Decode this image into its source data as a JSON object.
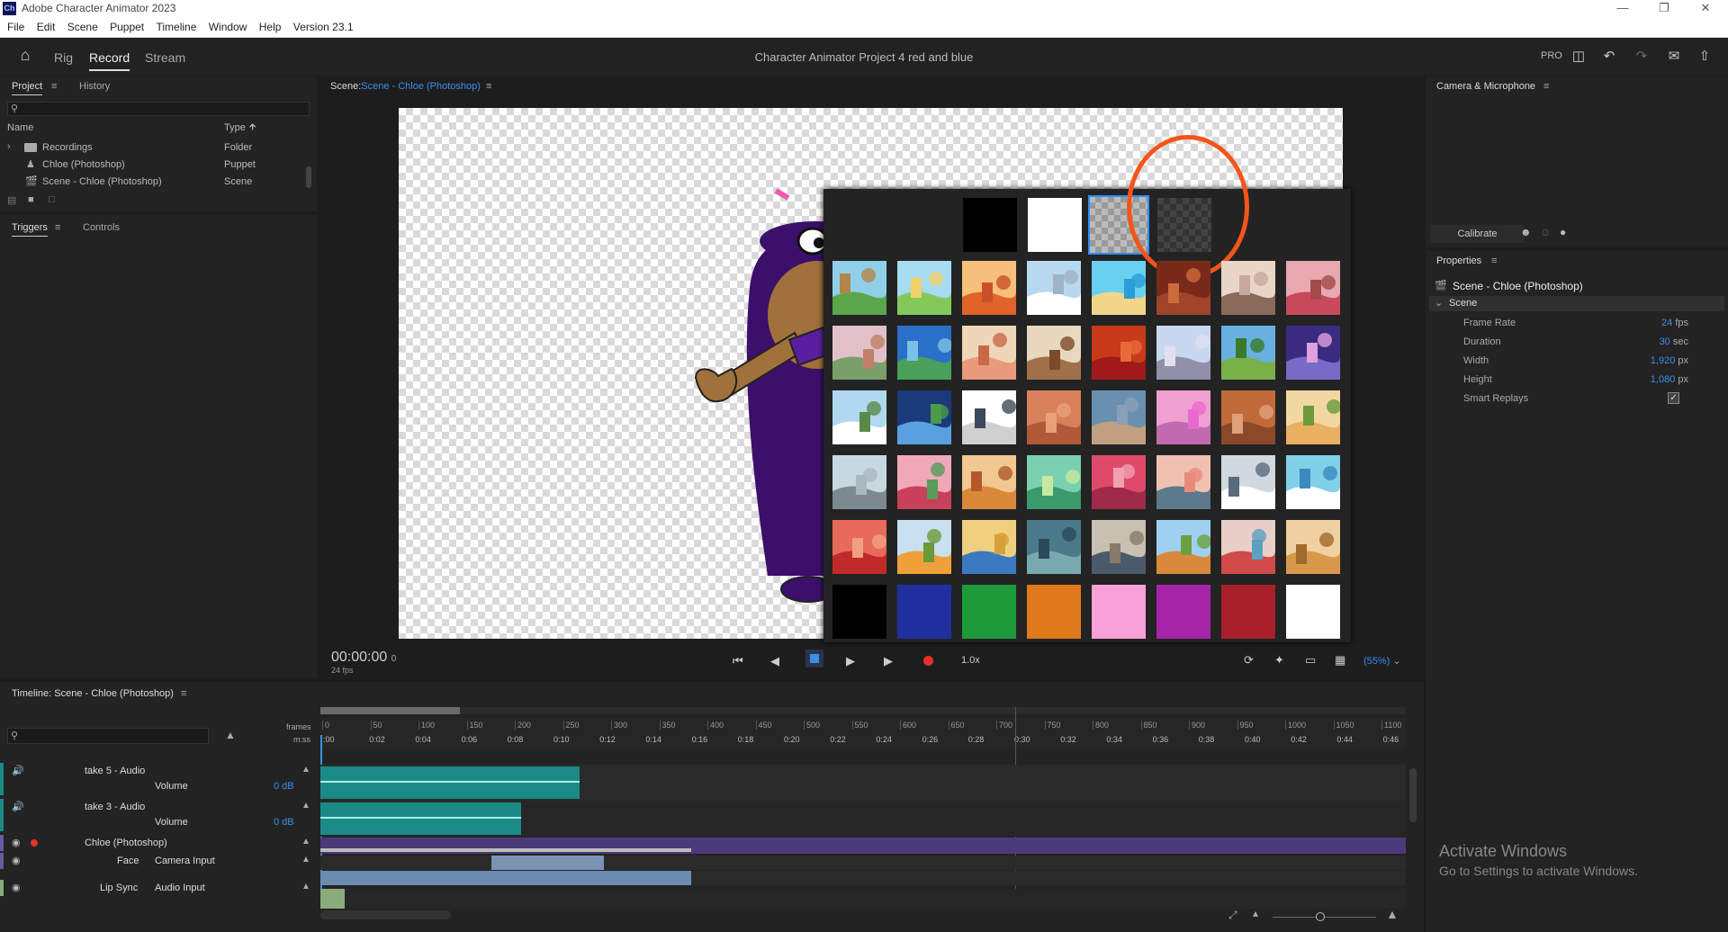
{
  "window": {
    "title": "Adobe Character Animator 2023",
    "app_badge": "Ch"
  },
  "menu": [
    "File",
    "Edit",
    "Scene",
    "Puppet",
    "Timeline",
    "Window",
    "Help",
    "Version 23.1"
  ],
  "header": {
    "modes": [
      "Rig",
      "Record",
      "Stream"
    ],
    "active_mode": "Record",
    "project_title": "Character Animator Project 4 red and blue",
    "pro_label": "PRO"
  },
  "project_panel": {
    "tabs": [
      "Project",
      "History"
    ],
    "columns": {
      "name": "Name",
      "type": "Type"
    },
    "items": [
      {
        "name": "Recordings",
        "type": "Folder",
        "icon": "folder-icon"
      },
      {
        "name": "Chloe (Photoshop)",
        "type": "Puppet",
        "icon": "puppet-icon"
      },
      {
        "name": "Scene - Chloe (Photoshop)",
        "type": "Scene",
        "icon": "scene-icon"
      }
    ]
  },
  "triggers_panel": {
    "tabs": [
      "Triggers",
      "Controls"
    ]
  },
  "scene_panel": {
    "label": "Scene:",
    "scene_name": "Scene - Chloe (Photoshop)",
    "timecode": "00:00:00",
    "timecode_frames": "0",
    "fps": "24 fps",
    "speed": "1.0x",
    "zoom": "(55%)"
  },
  "background_picker": {
    "top_row": [
      "transparent-black",
      "white",
      "gray-checker-selected",
      "dark-checker"
    ],
    "selected": "gray-checker-selected",
    "solid_colors": [
      "#000000",
      "#1f2fa0",
      "#1e9a3a",
      "#e07a1a",
      "#f7a1d8",
      "#a524a8",
      "#a8202a",
      "#ffffff"
    ]
  },
  "camera_panel": {
    "title": "Camera & Microphone",
    "calibrate": "Calibrate"
  },
  "properties_panel": {
    "title": "Properties",
    "object": "Scene - Chloe (Photoshop)",
    "section": "Scene",
    "rows": [
      {
        "label": "Frame Rate",
        "value": "24",
        "unit": "fps"
      },
      {
        "label": "Duration",
        "value": "30",
        "unit": "sec"
      },
      {
        "label": "Width",
        "value": "1,920",
        "unit": "px"
      },
      {
        "label": "Height",
        "value": "1,080",
        "unit": "px"
      },
      {
        "label": "Smart Replays",
        "value": "",
        "unit": ""
      }
    ]
  },
  "timeline": {
    "title": "Timeline: Scene - Chloe (Photoshop)",
    "frames_label": "frames",
    "mss_label": "m:ss",
    "frame_ticks": [
      "0",
      "50",
      "100",
      "150",
      "200",
      "250",
      "300",
      "350",
      "400",
      "450",
      "500",
      "550",
      "600",
      "650",
      "700",
      "750",
      "800",
      "850",
      "900",
      "950",
      "1000",
      "1050",
      "1100"
    ],
    "time_ticks": [
      ":00",
      "0:02",
      "0:04",
      "0:06",
      "0:08",
      "0:10",
      "0:12",
      "0:14",
      "0:16",
      "0:18",
      "0:20",
      "0:22",
      "0:24",
      "0:26",
      "0:28",
      "0:30",
      "0:32",
      "0:34",
      "0:36",
      "0:38",
      "0:40",
      "0:42",
      "0:44",
      "0:46"
    ],
    "tracks": [
      {
        "name": "take 5 - Audio",
        "sub": "Volume",
        "value": "0 dB"
      },
      {
        "name": "take 3 - Audio",
        "sub": "Volume",
        "value": "0 dB"
      },
      {
        "name": "Chloe (Photoshop)",
        "sub": "",
        "value": ""
      },
      {
        "name": "Face",
        "sub": "Camera Input",
        "value": ""
      },
      {
        "name": "Lip Sync",
        "sub": "Audio Input",
        "value": ""
      }
    ]
  },
  "watermark": {
    "title": "Activate Windows",
    "subtitle": "Go to Settings to activate Windows."
  }
}
